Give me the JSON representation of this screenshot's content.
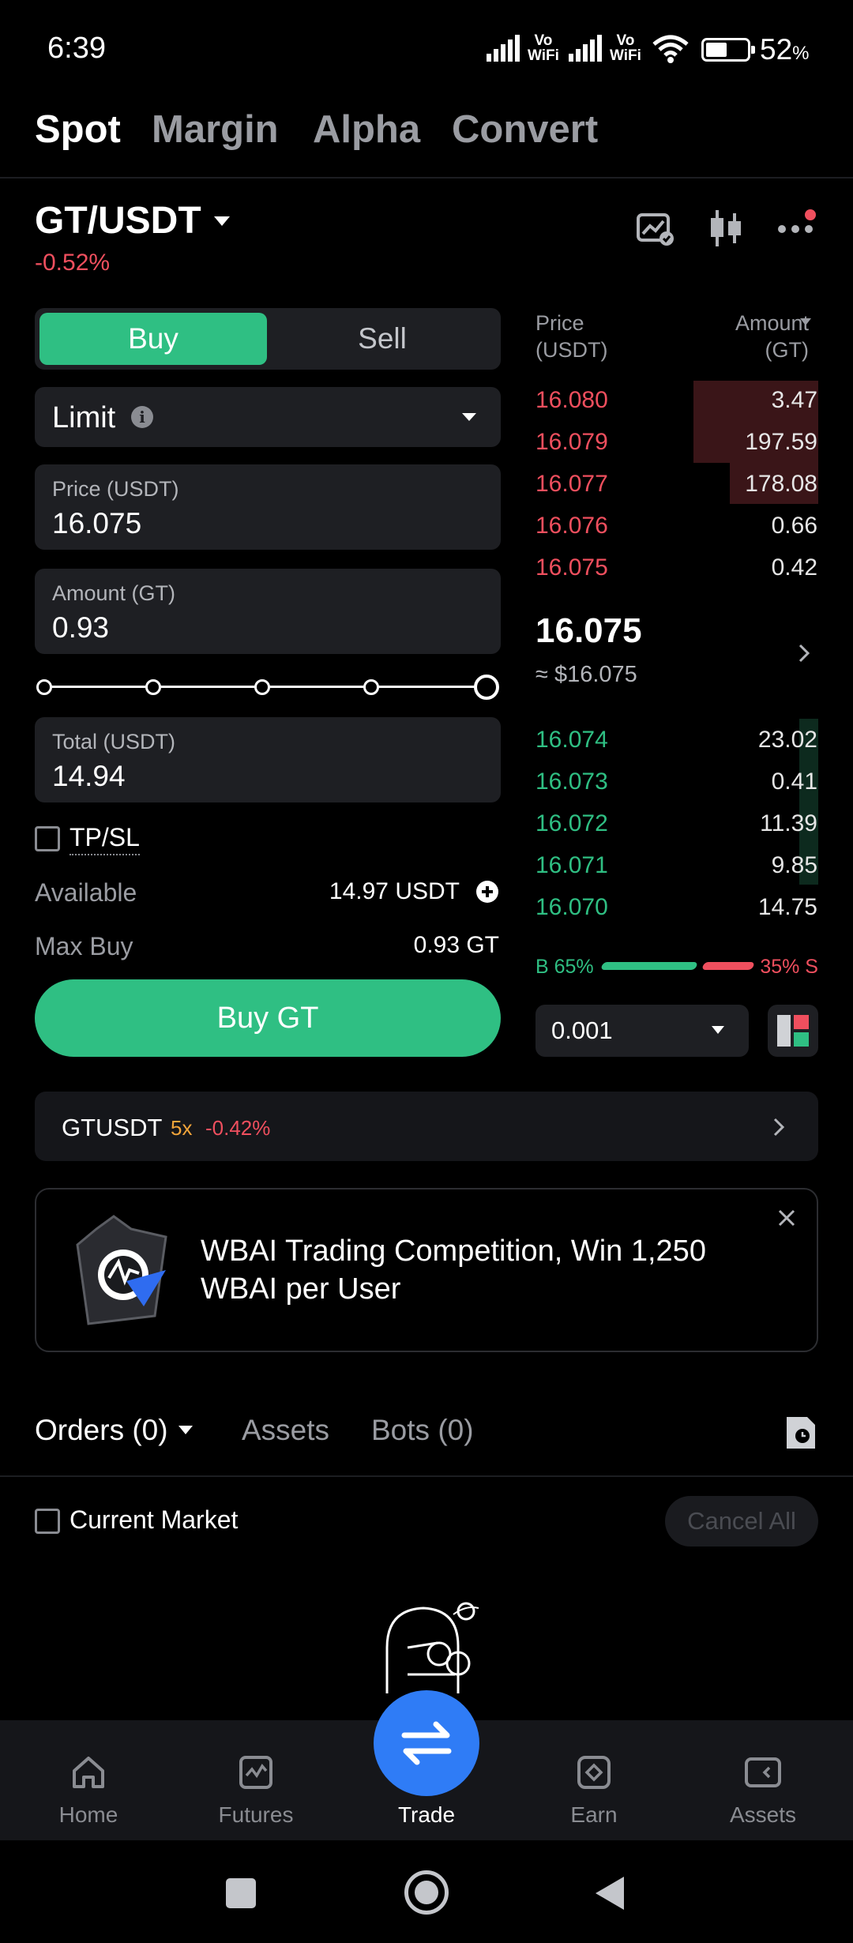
{
  "status_bar": {
    "time": "6:39",
    "net1": [
      "Vo",
      "WiFi"
    ],
    "net2": [
      "Vo",
      "WiFi"
    ],
    "battery_pct": "52",
    "battery_pct_sym": "%",
    "battery_level": 0.52
  },
  "top_tabs": {
    "spot": "Spot",
    "margin": "Margin",
    "alpha": "Alpha",
    "convert": "Convert"
  },
  "pair": {
    "name": "GT/USDT",
    "change": "-0.52%"
  },
  "order_form": {
    "buy_tab": "Buy",
    "sell_tab": "Sell",
    "order_type": "Limit",
    "price_label": "Price (USDT)",
    "price_value": "16.075",
    "amount_label": "Amount (GT)",
    "amount_value": "0.93",
    "slider_level": 1.0,
    "total_label": "Total (USDT)",
    "total_value": "14.94",
    "tpsl_label": "TP/SL",
    "available_label": "Available",
    "available_value": "14.97 USDT",
    "maxbuy_label": "Max Buy",
    "maxbuy_value": "0.93 GT",
    "submit_label": "Buy GT"
  },
  "order_book": {
    "price_header": [
      "Price",
      "(USDT)"
    ],
    "amount_header": [
      "Amount",
      "(GT)"
    ],
    "asks": [
      {
        "price": "16.080",
        "amount": "3.47"
      },
      {
        "price": "16.079",
        "amount": "197.59"
      },
      {
        "price": "16.077",
        "amount": "178.08"
      },
      {
        "price": "16.076",
        "amount": "0.66"
      },
      {
        "price": "16.075",
        "amount": "0.42"
      }
    ],
    "last_price": "16.075",
    "last_price_usd": "≈ $16.075",
    "bids": [
      {
        "price": "16.074",
        "amount": "23.02"
      },
      {
        "price": "16.073",
        "amount": "0.41"
      },
      {
        "price": "16.072",
        "amount": "11.39"
      },
      {
        "price": "16.071",
        "amount": "9.85"
      },
      {
        "price": "16.070",
        "amount": "14.75"
      }
    ],
    "buy_ratio_label": "B 65%",
    "sell_ratio_label": "35% S",
    "buy_ratio": 0.65,
    "precision": "0.001"
  },
  "futures_strip": {
    "symbol": "GTUSDT",
    "leverage": "5x",
    "change": "-0.42%"
  },
  "banner": {
    "text": "WBAI Trading Competition, Win 1,250 WBAI per User"
  },
  "orders": {
    "tab_orders": "Orders (0)",
    "tab_assets": "Assets",
    "tab_bots": "Bots (0)",
    "current_market": "Current Market",
    "cancel_all": "Cancel All"
  },
  "bottom_nav": {
    "home": "Home",
    "futures": "Futures",
    "trade": "Trade",
    "earn": "Earn",
    "assets": "Assets"
  },
  "colors": {
    "green": "#2fbf83",
    "red": "#ef4f5e",
    "accent_blue": "#2f7cf6",
    "bg": "#000000",
    "card": "#1e1f23"
  }
}
